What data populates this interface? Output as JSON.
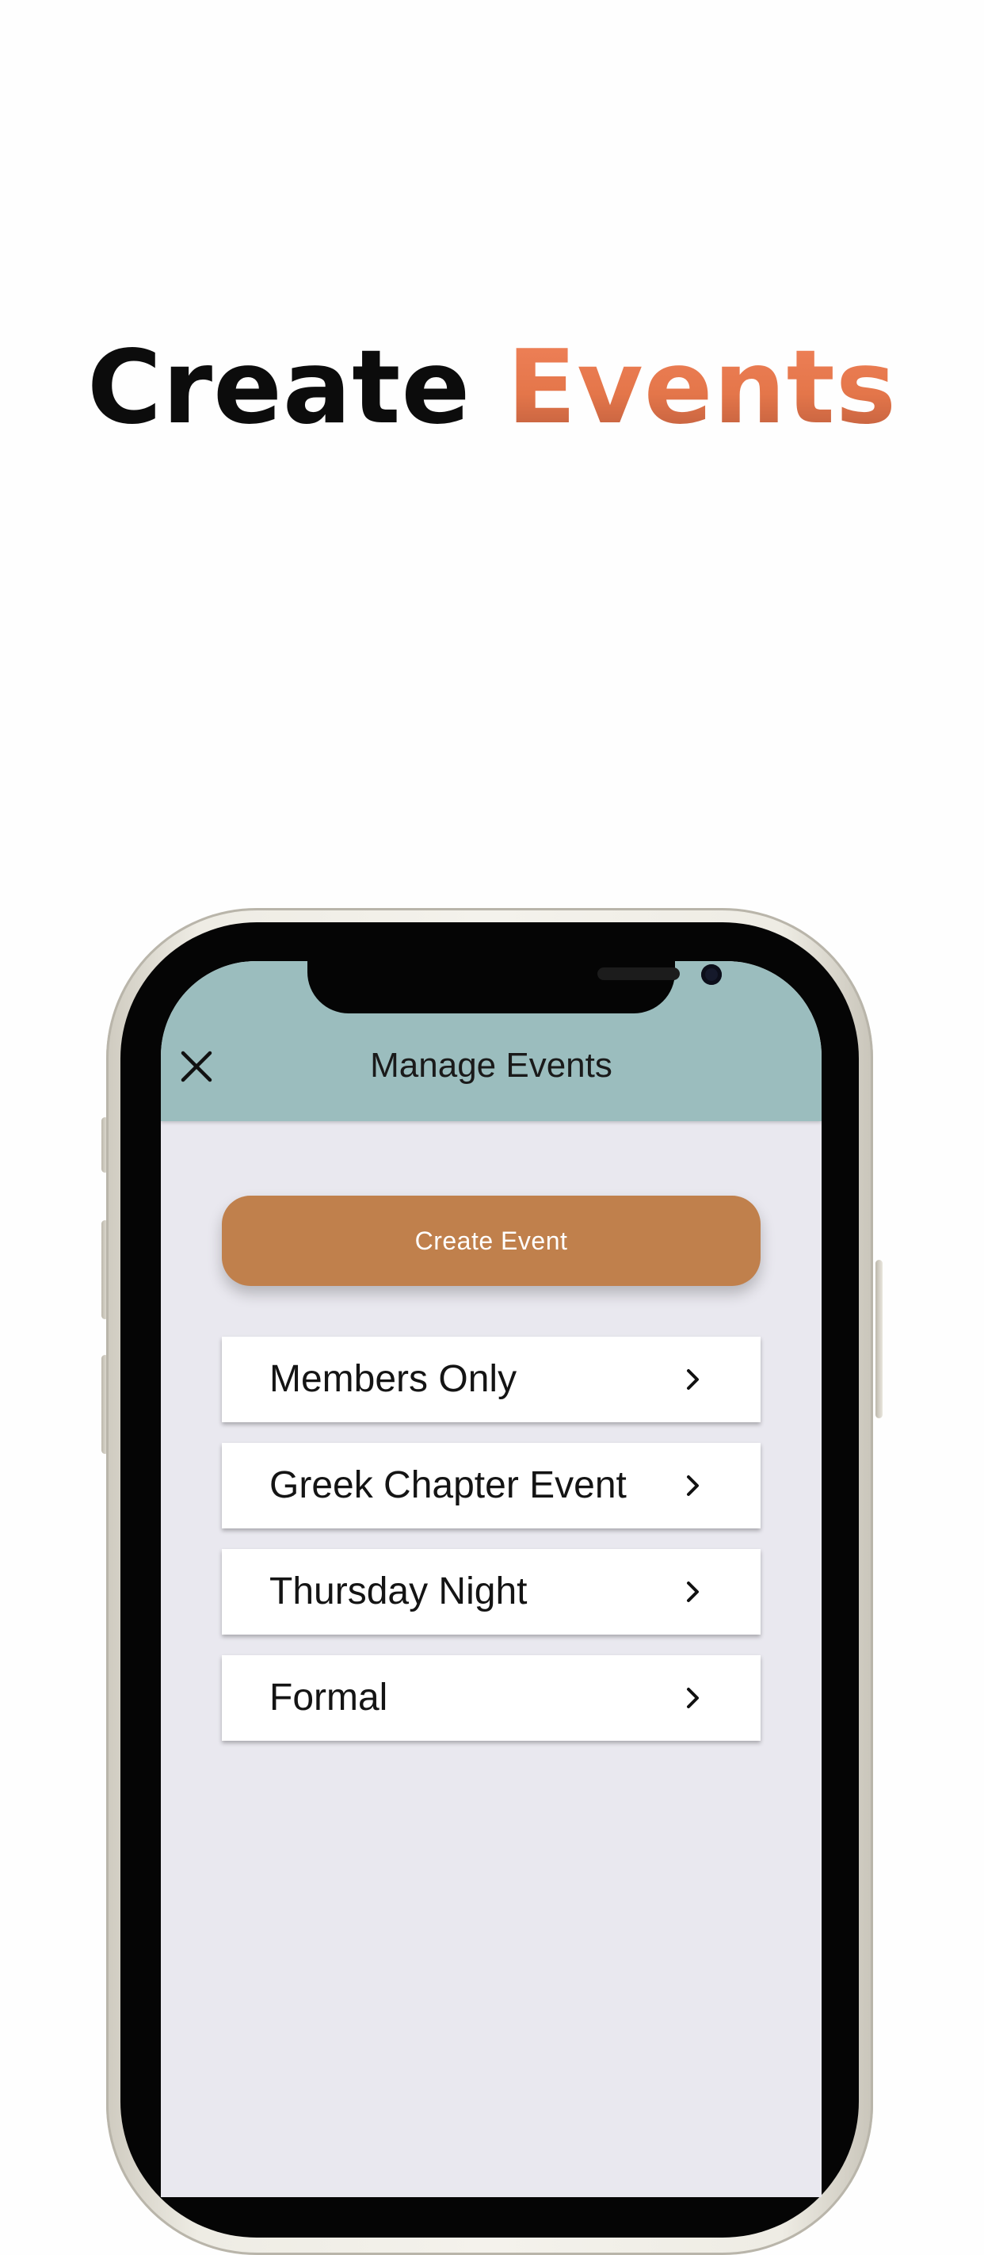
{
  "headline": {
    "word1": "Create",
    "word2": "Events"
  },
  "nav": {
    "title": "Manage Events",
    "close_icon": "close-icon"
  },
  "actions": {
    "create_label": "Create Event"
  },
  "events": [
    {
      "label": "Members Only"
    },
    {
      "label": "Greek Chapter Event"
    },
    {
      "label": "Thursday Night"
    },
    {
      "label": "Formal"
    }
  ],
  "colors": {
    "header_bg": "#9bbdbe",
    "screen_bg": "#e9e8ef",
    "accent_button": "#c0804c",
    "headline_accent": "#e4764a"
  }
}
